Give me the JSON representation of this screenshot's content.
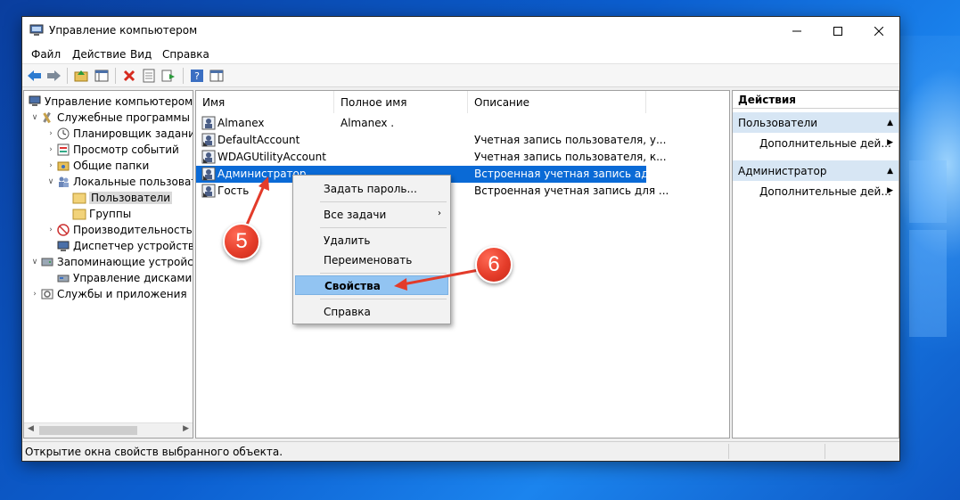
{
  "window": {
    "title": "Управление компьютером"
  },
  "menu": [
    "Файл",
    "Действие",
    "Вид",
    "Справка"
  ],
  "tree": [
    {
      "label": "Управление компьютером (л"
    },
    {
      "label": "Служебные программы"
    },
    {
      "label": "Планировщик заданий"
    },
    {
      "label": "Просмотр событий"
    },
    {
      "label": "Общие папки"
    },
    {
      "label": "Локальные пользоват"
    },
    {
      "label": "Пользователи"
    },
    {
      "label": "Группы"
    },
    {
      "label": "Производительность"
    },
    {
      "label": "Диспетчер устройств"
    },
    {
      "label": "Запоминающие устройст"
    },
    {
      "label": "Управление дисками"
    },
    {
      "label": "Службы и приложения"
    }
  ],
  "list": {
    "columns": [
      "Имя",
      "Полное имя",
      "Описание"
    ],
    "rows": [
      {
        "name": "Almanex",
        "full": "Almanex .",
        "desc": ""
      },
      {
        "name": "DefaultAccount",
        "full": "",
        "desc": "Учетная запись пользователя, у..."
      },
      {
        "name": "WDAGUtilityAccount",
        "full": "",
        "desc": "Учетная запись пользователя, к..."
      },
      {
        "name": "Администратор",
        "full": "",
        "desc": "Встроенная учетная запись адм..."
      },
      {
        "name": "Гость",
        "full": "",
        "desc": "Встроенная учетная запись для ..."
      }
    ]
  },
  "actions": {
    "title": "Действия",
    "sections": [
      {
        "label": "Пользователи",
        "item": "Дополнительные дей..."
      },
      {
        "label": "Администратор",
        "item": "Дополнительные дей..."
      }
    ]
  },
  "context_menu": [
    "Задать пароль...",
    "Все задачи",
    "Удалить",
    "Переименовать",
    "Свойства",
    "Справка"
  ],
  "status": "Открытие окна свойств выбранного объекта.",
  "badges": [
    "5",
    "6"
  ],
  "colors": {
    "selection": "#0a6ad6",
    "highlight": "#92c4f2",
    "badge": "#e53d2a"
  }
}
